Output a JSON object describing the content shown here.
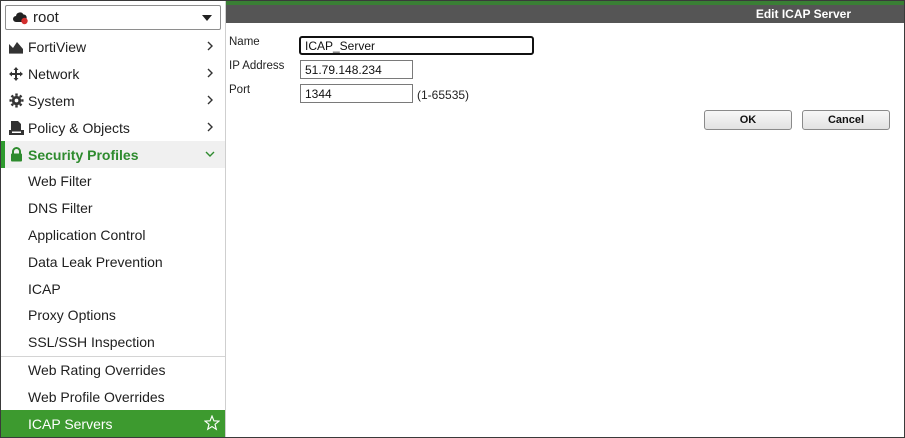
{
  "vdom": {
    "label": "root"
  },
  "nav": {
    "items": [
      {
        "label": "FortiView",
        "icon": "fortiview-icon"
      },
      {
        "label": "Network",
        "icon": "network-move-icon"
      },
      {
        "label": "System",
        "icon": "gear-icon"
      },
      {
        "label": "Policy & Objects",
        "icon": "policy-doc-icon"
      },
      {
        "label": "Security Profiles",
        "icon": "lock-icon"
      }
    ],
    "security_sub": [
      "Web Filter",
      "DNS Filter",
      "Application Control",
      "Data Leak Prevention",
      "ICAP",
      "Proxy Options",
      "SSL/SSH Inspection",
      "Web Rating Overrides",
      "Web Profile Overrides",
      "ICAP Servers"
    ]
  },
  "dialog": {
    "title": "Edit ICAP Server",
    "name_label": "Name",
    "name_value": "ICAP_Server",
    "ip_label": "IP Address",
    "ip_value": "51.79.148.234",
    "port_label": "Port",
    "port_value": "1344",
    "port_hint": "(1-65535)",
    "ok_label": "OK",
    "cancel_label": "Cancel"
  },
  "colors": {
    "accent_green": "#3d9a2f",
    "title_bar": "#555555"
  }
}
